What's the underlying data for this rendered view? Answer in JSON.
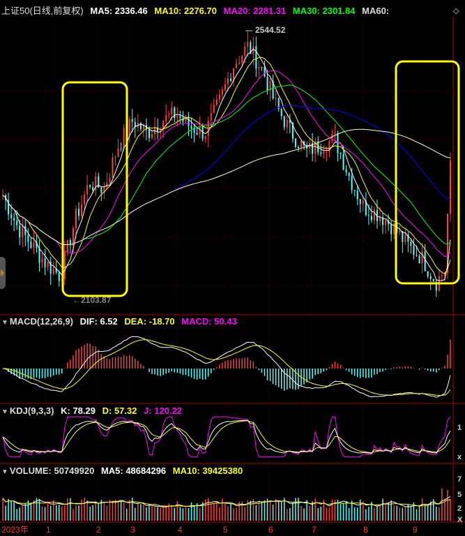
{
  "main_legend": {
    "name": "上证50(日线,前复权)",
    "ma5": "MA5: 2336.46",
    "ma10": "MA10: 2276.70",
    "ma20": "MA20: 2281.31",
    "ma30": "MA30: 2301.84",
    "ma60": "MA60:"
  },
  "price_annotations": {
    "high": "2544.52",
    "low": "←2103.87"
  },
  "macd_legend": {
    "name": "MACD(12,26,9)",
    "dif": "DIF: 6.52",
    "dea": "DEA: -18.70",
    "macd": "MACD: 50.43"
  },
  "kdj_legend": {
    "name": "KDJ(9,3,3)",
    "k": "K: 78.29",
    "d": "D: 57.32",
    "j": "J: 120.22"
  },
  "volume_legend": {
    "name": "VOLUME: 50749920",
    "ma5": "MA5: 48684296",
    "ma10": "MA10: 39425380"
  },
  "month_axis": [
    "2023年",
    "1",
    "2",
    "3",
    "4",
    "5",
    "6",
    "7",
    "8",
    "9"
  ],
  "right_axis": {
    "kdj_ticks": [
      "1",
      "x"
    ],
    "volume_ticks": [
      "7",
      "5",
      "2",
      "X"
    ]
  },
  "colors": {
    "up": "#ff4040",
    "down": "#54ffff",
    "ma5": "#ffffff",
    "ma10": "#ffff00",
    "ma20": "#ff00ff",
    "ma30": "#00ff00",
    "ma60": "#0000ff",
    "ma_long": "#ffffcc",
    "highlight": "#ffff00",
    "separator": "#b00000"
  },
  "chart_data": {
    "type": "candlestick",
    "x_range": [
      "2023-01",
      "2023-09"
    ],
    "y_range": [
      2100,
      2560
    ],
    "price_high": 2544.52,
    "price_low": 2103.87,
    "anchor_closes": [
      2280,
      2230,
      2200,
      2170,
      2150,
      2240,
      2300,
      2290,
      2360,
      2400,
      2380,
      2400,
      2410,
      2390,
      2380,
      2430,
      2490,
      2520,
      2480,
      2420,
      2380,
      2350,
      2360,
      2370,
      2310,
      2260,
      2250,
      2230,
      2200,
      2180,
      2140,
      2170
    ],
    "highlight_ranges": [
      [
        "2023-01",
        "2023-02"
      ],
      [
        "2023-09",
        "2023-09"
      ]
    ],
    "indicators": [
      "MA5",
      "MA10",
      "MA20",
      "MA30",
      "MA60",
      "MACD(12,26,9)",
      "KDJ(9,3,3)",
      "VOLUME"
    ]
  }
}
